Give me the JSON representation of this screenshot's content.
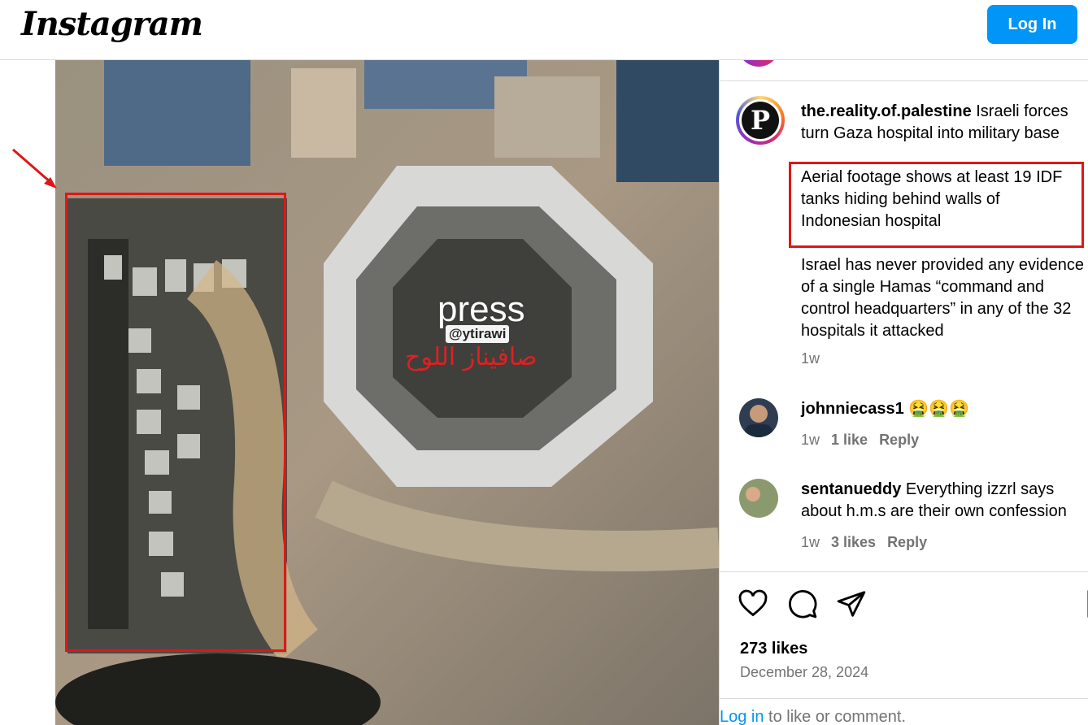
{
  "header": {
    "logo": "Instagram",
    "login_button": "Log In"
  },
  "media": {
    "watermark_text": "press",
    "watermark_handle": "@ytirawi",
    "arabic_text": "صافيناز اللوح"
  },
  "post": {
    "author": "the.reality.of.palestine",
    "caption_title": "Israeli forces turn Gaza hospital into military base",
    "caption_highlight": "Aerial footage shows at least 19 IDF tanks hiding behind walls of Indonesian hospital",
    "caption_body": "Israel has never provided any evidence of a single Hamas “command and control headquarters” in any of the 32 hospitals it attacked",
    "caption_age": "1w"
  },
  "comments": [
    {
      "user": "johnniecass1",
      "text": "🤮🤮🤮",
      "age": "1w",
      "likes": "1 like",
      "reply": "Reply"
    },
    {
      "user": "sentanueddy",
      "text": "Everything izzrl says about h.m.s are their own confession",
      "age": "1w",
      "likes": "3 likes",
      "reply": "Reply"
    }
  ],
  "footer": {
    "likes": "273 likes",
    "date": "December 28, 2024",
    "login_link": "Log in",
    "login_suffix": " to like or comment."
  },
  "icons": [
    "heart-icon",
    "comment-icon",
    "share-icon",
    "bookmark-icon"
  ],
  "colors": {
    "brand_blue": "#0095f6",
    "annotation_red": "#e01616",
    "muted": "#737373"
  }
}
